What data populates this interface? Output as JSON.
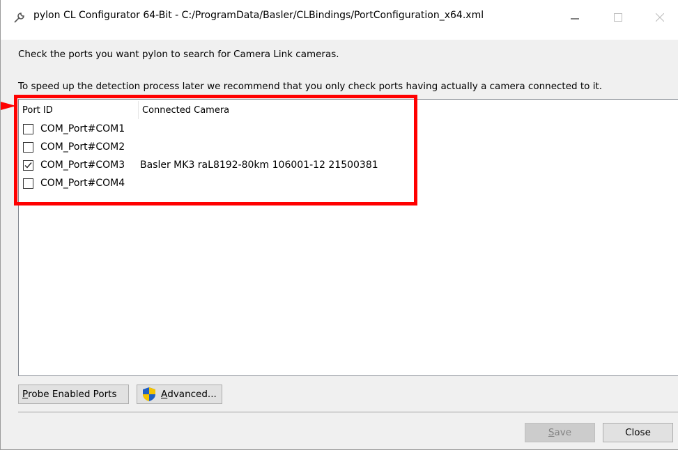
{
  "window": {
    "title": "pylon CL Configurator 64-Bit - C:/ProgramData/Basler/CLBindings/PortConfiguration_x64.xml"
  },
  "instructions": {
    "line1": "Check the ports you want pylon to search for Camera Link cameras.",
    "line2": "To speed up the detection process later we recommend that you only check ports having actually a camera connected to it."
  },
  "table": {
    "columns": [
      "Port ID",
      "Connected Camera"
    ],
    "rows": [
      {
        "port": "COM_Port#COM1",
        "camera": "",
        "checked": false
      },
      {
        "port": "COM_Port#COM2",
        "camera": "",
        "checked": false
      },
      {
        "port": "COM_Port#COM3",
        "camera": "Basler MK3 raL8192-80km 106001-12 21500381",
        "checked": true
      },
      {
        "port": "COM_Port#COM4",
        "camera": "",
        "checked": false
      }
    ]
  },
  "buttons": {
    "probe": {
      "accel": "P",
      "rest": "robe Enabled Ports"
    },
    "advanced": {
      "accel": "A",
      "rest": "dvanced..."
    },
    "save": {
      "accel": "S",
      "rest": "ave",
      "enabled": false
    },
    "close": "Close"
  },
  "icons": {
    "title": "wrench-icon",
    "shield": "uac-shield-icon"
  },
  "colors": {
    "highlight": "#ff0000",
    "accent_blue": "#1e5fc4",
    "shield_yellow": "#f5c400"
  }
}
